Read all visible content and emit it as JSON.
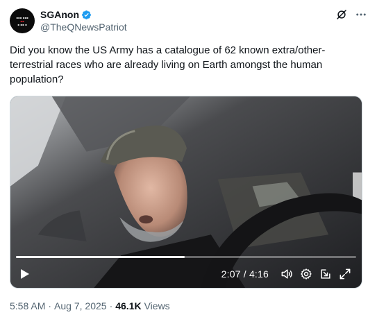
{
  "author": {
    "display_name": "SGAnon",
    "handle": "@TheQNewsPatriot",
    "verified_color": "#1d9bf0"
  },
  "tweet": {
    "text": "Did you know the US Army has a catalogue of 62 known extra/other-terrestrial races who are already living on Earth amongst the human population?"
  },
  "video": {
    "time_display": "2:07 / 4:16",
    "progress_fraction": 0.496,
    "controls": [
      "play-icon",
      "volume-icon",
      "settings-icon",
      "pip-icon",
      "fullscreen-icon"
    ]
  },
  "meta": {
    "time": "5:58 AM",
    "separator": "·",
    "date": "Aug 7, 2025",
    "views_count": "46.1K",
    "views_label": "Views"
  },
  "header_icons": [
    "grok-icon",
    "more-icon"
  ]
}
